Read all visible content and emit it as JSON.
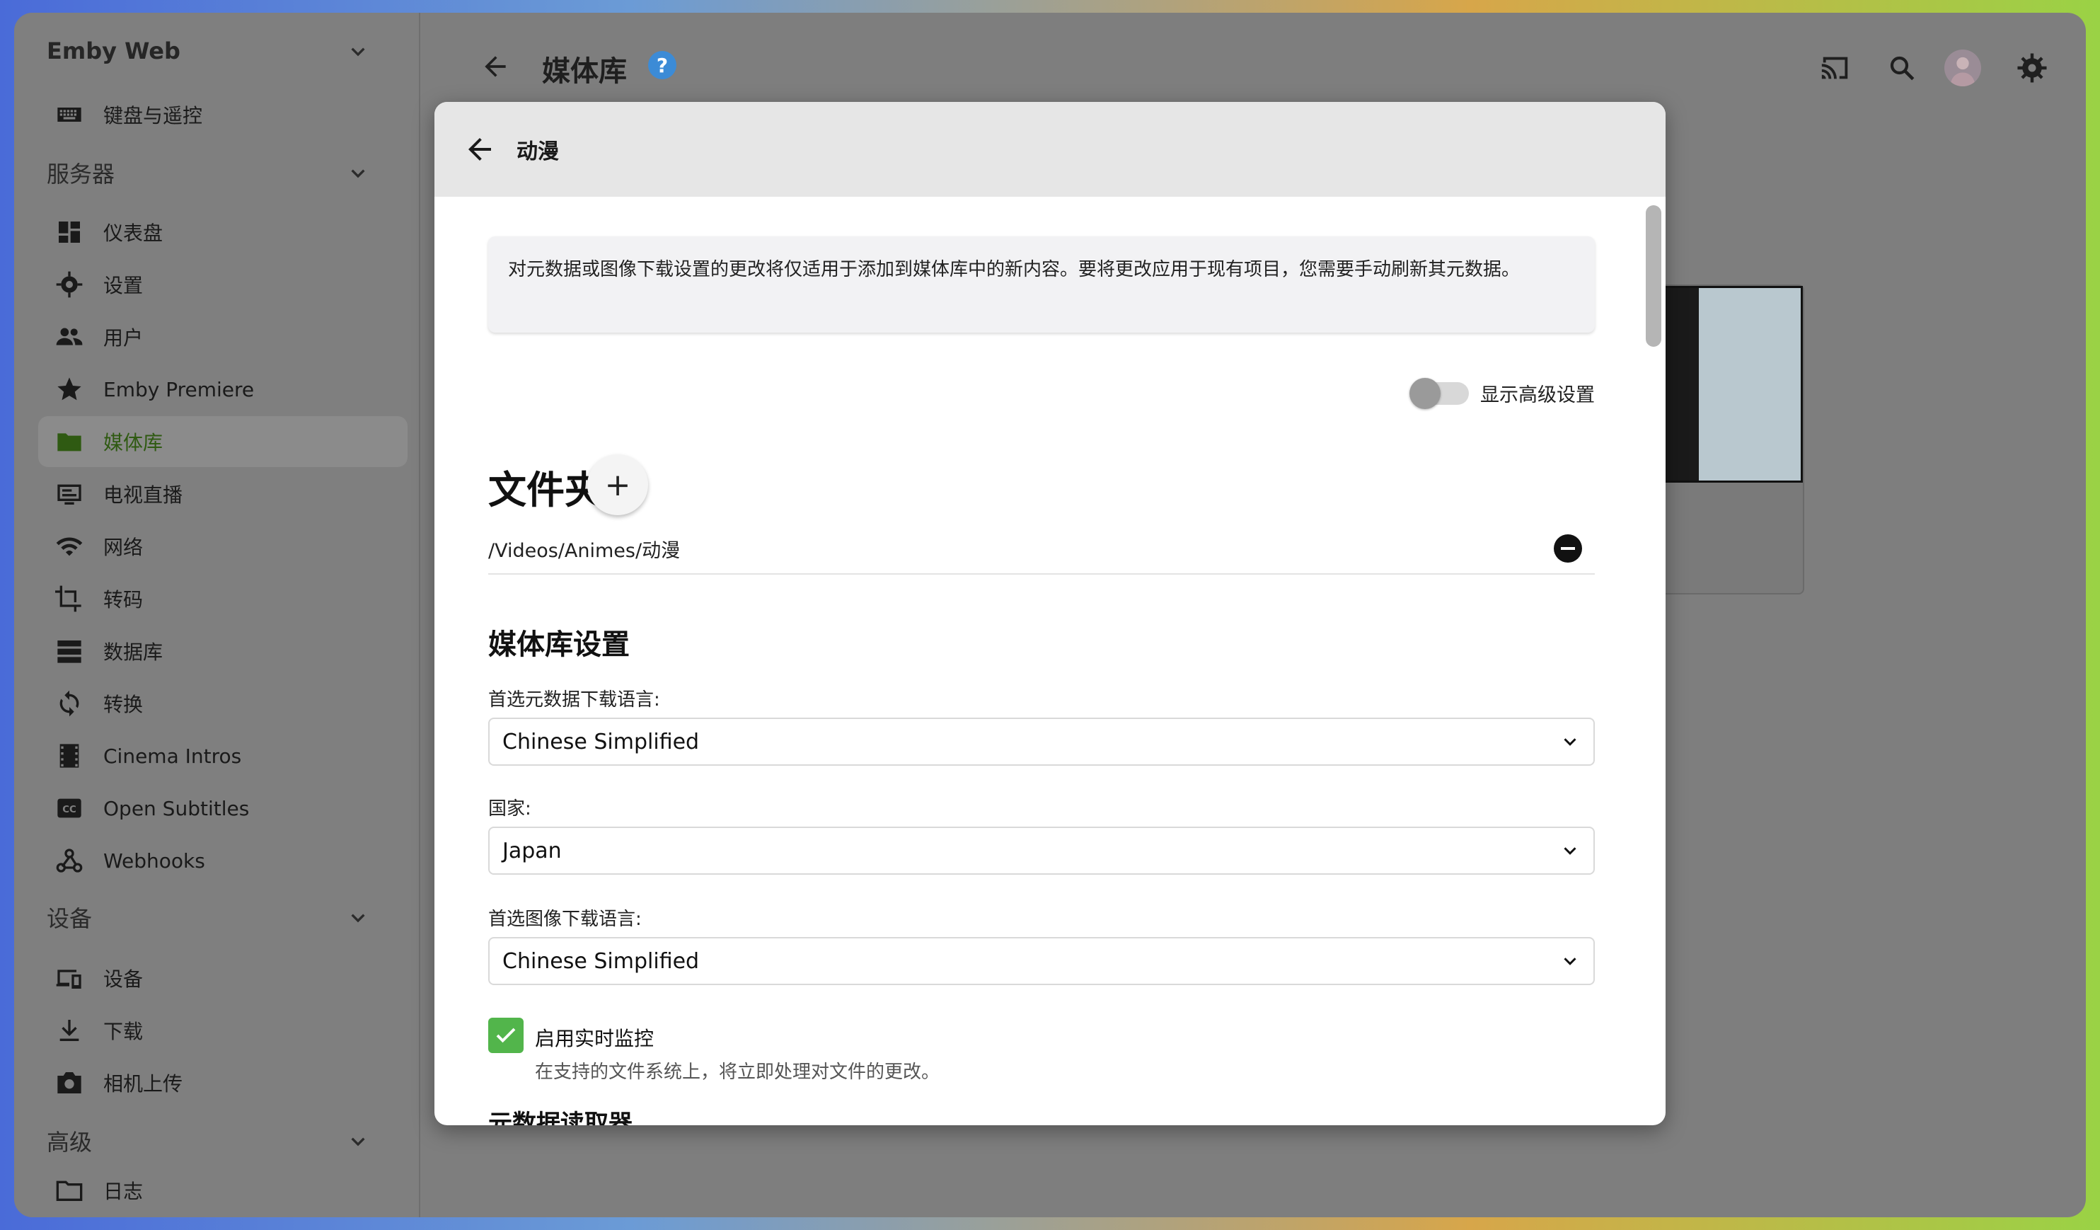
{
  "sidebar": {
    "app_title": "Emby Web",
    "top_items": [
      {
        "label": "键盘与遥控",
        "icon": "keyboard-icon"
      }
    ],
    "server_header": "服务器",
    "server_items": [
      {
        "label": "仪表盘",
        "icon": "dashboard-icon"
      },
      {
        "label": "设置",
        "icon": "gear-icon"
      },
      {
        "label": "用户",
        "icon": "people-icon"
      },
      {
        "label": "Emby Premiere",
        "icon": "star-icon"
      },
      {
        "label": "媒体库",
        "icon": "folder-icon"
      },
      {
        "label": "电视直播",
        "icon": "tv-guide-icon"
      },
      {
        "label": "网络",
        "icon": "wifi-icon"
      },
      {
        "label": "转码",
        "icon": "crop-icon"
      },
      {
        "label": "数据库",
        "icon": "database-icon"
      },
      {
        "label": "转换",
        "icon": "sync-icon"
      },
      {
        "label": "Cinema Intros",
        "icon": "film-icon"
      },
      {
        "label": "Open Subtitles",
        "icon": "cc-icon"
      },
      {
        "label": "Webhooks",
        "icon": "webhook-icon"
      }
    ],
    "devices_header": "设备",
    "devices_items": [
      {
        "label": "设备",
        "icon": "devices-icon"
      },
      {
        "label": "下载",
        "icon": "download-icon"
      },
      {
        "label": "相机上传",
        "icon": "camera-icon"
      }
    ],
    "advanced_header": "高级",
    "advanced_items": [
      {
        "label": "日志",
        "icon": "folder-outline-icon"
      }
    ]
  },
  "topbar": {
    "title": "媒体库",
    "help": "?"
  },
  "dialog": {
    "title": "动漫",
    "notice": "对元数据或图像下载设置的更改将仅适用于添加到媒体库中的新内容。要将更改应用于现有项目，您需要手动刷新其元数据。",
    "advanced_toggle_label": "显示高级设置",
    "folders_heading": "文件夹",
    "add_symbol": "+",
    "folder_path": "/Videos/Animes/动漫",
    "library_settings_heading": "媒体库设置",
    "metadata_lang_label": "首选元数据下载语言:",
    "metadata_lang_value": "Chinese Simplified",
    "country_label": "国家:",
    "country_value": "Japan",
    "image_lang_label": "首选图像下载语言:",
    "image_lang_value": "Chinese Simplified",
    "realtime_label": "启用实时监控",
    "realtime_desc": "在支持的文件系统上，将立即处理对文件的更改。",
    "cut_heading": "元数据读取器"
  },
  "colors": {
    "accent": "#52b54b",
    "active_nav": "#2f5a12",
    "help": "#3c8bd6"
  }
}
